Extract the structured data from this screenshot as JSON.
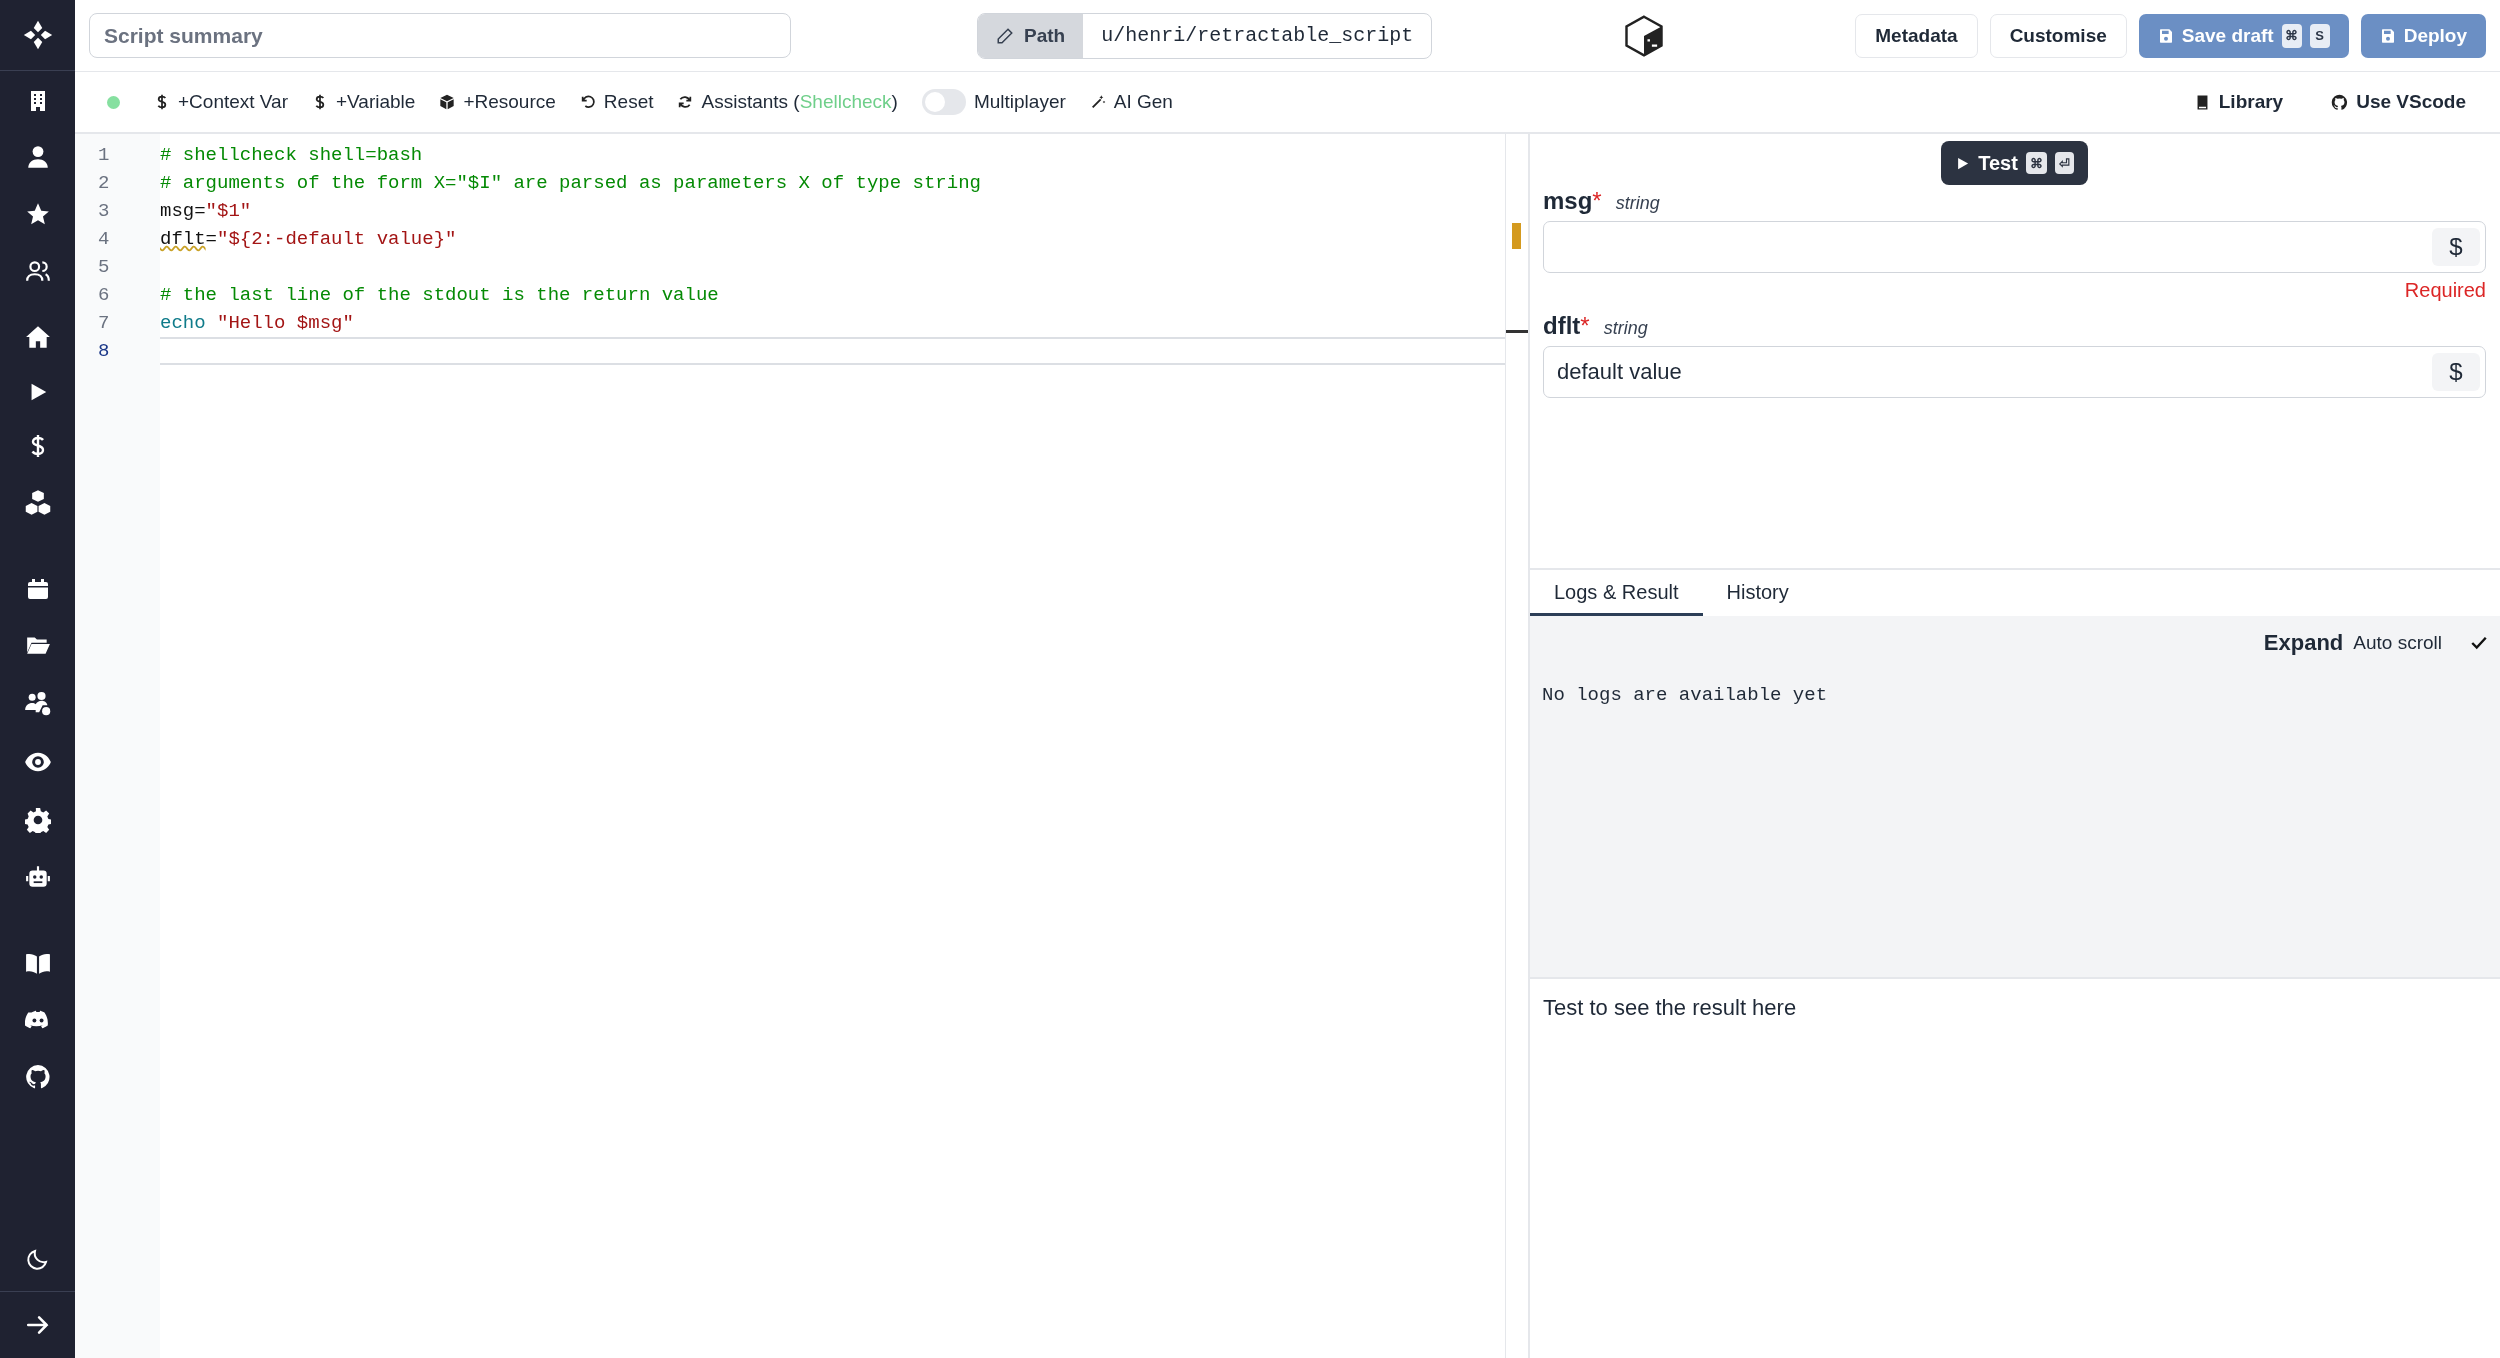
{
  "header": {
    "summary_placeholder": "Script summary",
    "path_label": "Path",
    "path_value": "u/henri/retractable_script",
    "buttons": [
      {
        "label": "Metadata",
        "kind": "plain"
      },
      {
        "label": "Customise",
        "kind": "plain"
      },
      {
        "label": "Save draft",
        "kind": "primary",
        "keys": [
          "⌘",
          "S"
        ]
      },
      {
        "label": "Deploy",
        "kind": "primary"
      }
    ]
  },
  "toolbar": {
    "items": [
      {
        "kind": "action",
        "label": "+Context Var"
      },
      {
        "kind": "action",
        "label": "+Variable"
      },
      {
        "kind": "action",
        "label": "+Resource"
      },
      {
        "kind": "action",
        "label": "Reset"
      },
      {
        "kind": "assistant",
        "label": "Assistants (",
        "detail": "Shellcheck",
        "suffix": ")"
      },
      {
        "kind": "toggle",
        "label": "Multiplayer",
        "on": false
      },
      {
        "kind": "action",
        "label": "AI Gen"
      }
    ],
    "right": [
      {
        "label": "Library"
      },
      {
        "label": "Use VScode"
      }
    ]
  },
  "editor": {
    "lines": [
      {
        "number": "1",
        "current": false,
        "tokens": [
          {
            "kind": "comment",
            "text": "# shellcheck shell=bash"
          }
        ]
      },
      {
        "number": "2",
        "current": false,
        "tokens": [
          {
            "kind": "comment",
            "text": "# arguments of the form X=\"$I\" are parsed as parameters X of type string"
          }
        ]
      },
      {
        "number": "3",
        "current": false,
        "tokens": [
          {
            "kind": "plain",
            "text": "msg="
          },
          {
            "kind": "string",
            "text": "\"$1\""
          }
        ]
      },
      {
        "number": "4",
        "current": false,
        "tokens": [
          {
            "kind": "flagged",
            "text": "dflt"
          },
          {
            "kind": "plain",
            "text": "="
          },
          {
            "kind": "string",
            "text": "\"${2:-default value}\""
          }
        ]
      },
      {
        "number": "5",
        "current": false
      },
      {
        "number": "6",
        "current": false,
        "tokens": [
          {
            "kind": "comment",
            "text": "# the last line of the stdout is the return value"
          }
        ]
      },
      {
        "number": "7",
        "current": false,
        "tokens": [
          {
            "kind": "keyword",
            "text": "echo "
          },
          {
            "kind": "string",
            "text": "\"Hello $msg\""
          }
        ]
      },
      {
        "number": "8",
        "current": true
      }
    ]
  },
  "test_panel": {
    "test_button": {
      "label": "Test",
      "keys": [
        "⌘",
        "⏎"
      ]
    },
    "args": [
      {
        "name": "msg",
        "required_mark": "*",
        "type": "string",
        "expr_button": "$",
        "error": "Required"
      },
      {
        "name": "dflt",
        "required_mark": "*",
        "type": "string",
        "value": "default value",
        "expr_button": "$"
      }
    ]
  },
  "logs": {
    "tabs": [
      {
        "label": "Logs & Result",
        "selected": true
      },
      {
        "label": "History",
        "selected": false
      }
    ],
    "expand": "Expand",
    "auto_scroll": {
      "label": "Auto scroll",
      "checked": true
    },
    "log_text": "No logs are available yet",
    "result_hint": "Test to see the result here"
  }
}
